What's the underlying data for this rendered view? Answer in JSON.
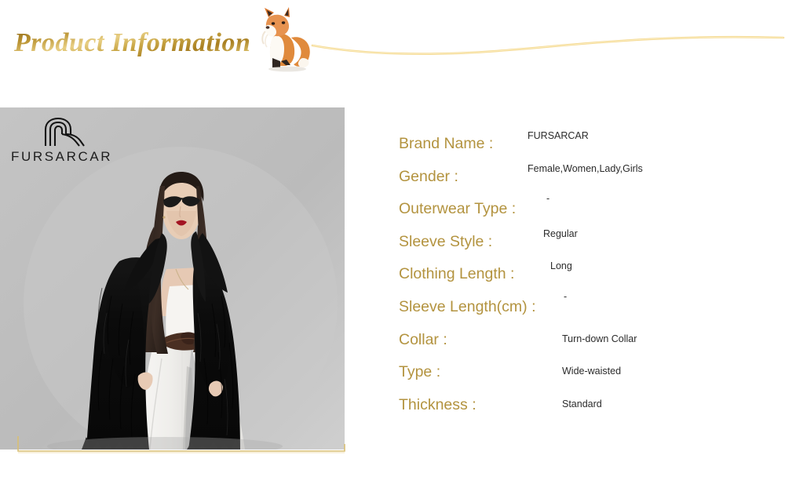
{
  "header": {
    "title": "Product Information",
    "fox_icon": "fox-illustration-icon",
    "wave_icon": "gold-wave-divider-icon",
    "title_color": "#b8912f",
    "wave_color": "#f3d78f"
  },
  "product_photo": {
    "alt": "Woman wearing long black fur coat with white trousers",
    "backdrop_color": "#bcbcbc",
    "coat_color": "#0e0e0e",
    "trousers_color": "#f4f3f1",
    "belt_color": "#4a2f22",
    "accent_color": "#d9bf73",
    "brand_logo": {
      "mark": "fursarcar-monogram-icon",
      "wordmark": "FURSARCAR"
    }
  },
  "specs": {
    "label_color": "#b3933f",
    "value_color": "#2b2b2b",
    "rows": [
      {
        "label": "Brand Name :",
        "value": "FURSARCAR"
      },
      {
        "label": "Gender :",
        "value": "Female,Women,Lady,Girls"
      },
      {
        "label": "Outerwear Type :",
        "value": "-"
      },
      {
        "label": "Sleeve Style :",
        "value": "Regular"
      },
      {
        "label": "Clothing Length :",
        "value": "Long"
      },
      {
        "label": "Sleeve Length(cm) :",
        "value": "-"
      },
      {
        "label": "Collar :",
        "value": "Turn-down Collar"
      },
      {
        "label": "Type :",
        "value": "Wide-waisted"
      },
      {
        "label": "Thickness :",
        "value": "Standard"
      }
    ]
  }
}
